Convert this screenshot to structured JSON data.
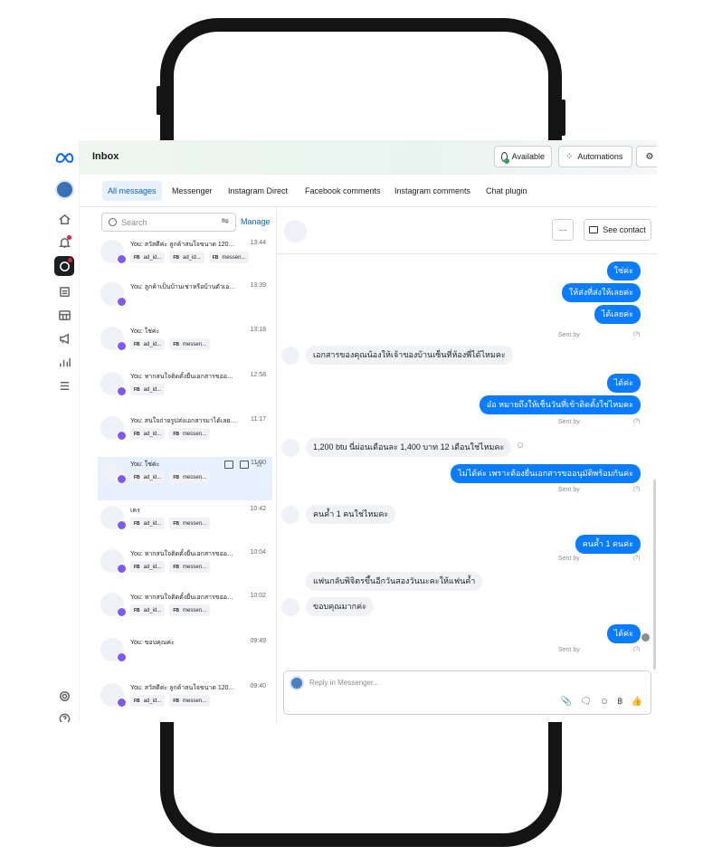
{
  "app": {
    "title": "Inbox",
    "available_label": "Available",
    "automations_label": "Automations"
  },
  "tabs": [
    {
      "label": "All messages",
      "active": true
    },
    {
      "label": "Messenger"
    },
    {
      "label": "Instagram Direct"
    },
    {
      "label": "Facebook comments"
    },
    {
      "label": "Instagram comments"
    },
    {
      "label": "Chat plugin"
    }
  ],
  "search": {
    "placeholder": "Search"
  },
  "manage_label": "Manage",
  "conversations": [
    {
      "snippet": "You: สวัสดีค่ะ ลูกค้าสนใจขนาด 12000 BTU...",
      "time": "13:44",
      "tags": [
        "ad_id...",
        "ad_id...",
        "messen..."
      ]
    },
    {
      "snippet": "You: ลูกค้าเป็นบ้านเช่าหรือบ้านตัวเองคะ",
      "time": "13:39",
      "tags": []
    },
    {
      "snippet": "You: ใช่ค่ะ",
      "time": "13:18",
      "tags": [
        "ad_id...",
        "messen..."
      ]
    },
    {
      "snippet": "You: หากสนใจติดตั้งยื่นเอกสารขออนุมั...",
      "time": "12:58",
      "tags": [
        "ad_id..."
      ]
    },
    {
      "snippet": "You: สนใจถ่ายรูปส่งเอกสารมาได้เลยนะได้...",
      "time": "11:17",
      "tags": [
        "ad_id...",
        "messen..."
      ]
    },
    {
      "snippet": "You: ใช่ค่ะ",
      "time": "11:00",
      "tags": [
        "ad_id...",
        "messen..."
      ],
      "selected": true
    },
    {
      "snippet": "เคร",
      "time": "10:42",
      "tags": [
        "ad_id...",
        "messen..."
      ]
    },
    {
      "snippet": "You: หากสนใจติดตั้งยื่นเอกสารขออนุมั...",
      "time": "10:04",
      "tags": [
        "ad_id...",
        "messen..."
      ]
    },
    {
      "snippet": "You: หากสนใจติดตั้งยื่นเอกสารขออนุมั...",
      "time": "10:02",
      "tags": [
        "ad_id...",
        "messen..."
      ]
    },
    {
      "snippet": "You: ขอบคุณค่ะ",
      "time": "09:49",
      "tags": []
    },
    {
      "snippet": "You: สวัสดีค่ะ ลูกค้าสนใจขนาด 12000 BTU...",
      "time": "09:40",
      "tags": [
        "ad_id...",
        "messen..."
      ]
    }
  ],
  "tag_prefix": "FB",
  "chat": {
    "more_label": "···",
    "see_contact_label": "See contact",
    "sent_by_label": "Sent by",
    "sent_by_mark": "(?)",
    "reply_placeholder": "Reply in Messenger...",
    "messages": [
      {
        "dir": "out",
        "text": "ใช่ค่ะ"
      },
      {
        "dir": "out",
        "text": "ให้ส่งที่ส่งให้เลยค่ะ"
      },
      {
        "dir": "out",
        "text": "ได้เลยค่ะ"
      },
      {
        "dir": "in",
        "text": "เอกสารของคุณน้องให้เจ้าของบ้านเซ็นที่ห้องพี่ได้ไหมคะ"
      },
      {
        "dir": "out",
        "text": "ได้ค่ะ"
      },
      {
        "dir": "out",
        "text": "อ๋อ หมายถึงให้เซ็นวันที่เข้าติดตั้งใช่ไหมคะ"
      },
      {
        "dir": "in",
        "text": "1,200 btu นี่ผ่อนเดือนละ 1,400 บาท 12 เดือนใช่ไหมคะ"
      },
      {
        "dir": "out",
        "text": "ไม่ได้ค่ะ เพราะต้องยื่นเอกสารขออนุมัติพร้อมกันค่ะ"
      },
      {
        "dir": "in",
        "text": "คนค้ำ 1 คนใช่ไหมคะ"
      },
      {
        "dir": "out",
        "text": "คนค้ำ 1 คนค่ะ"
      },
      {
        "dir": "in",
        "text": "แฟนกลับพิจิตรขึ้นอีกวันสองวันนะคะให้แฟนค้ำ"
      },
      {
        "dir": "in",
        "text": "ขอบคุณมากค่ะ"
      },
      {
        "dir": "out",
        "text": "ได้ค่ะ"
      }
    ]
  },
  "colors": {
    "accent": "#0a7cff",
    "tab_active_bg": "#e7f0fd",
    "badge": "#7e5bf0",
    "status_green": "#31a24c"
  }
}
